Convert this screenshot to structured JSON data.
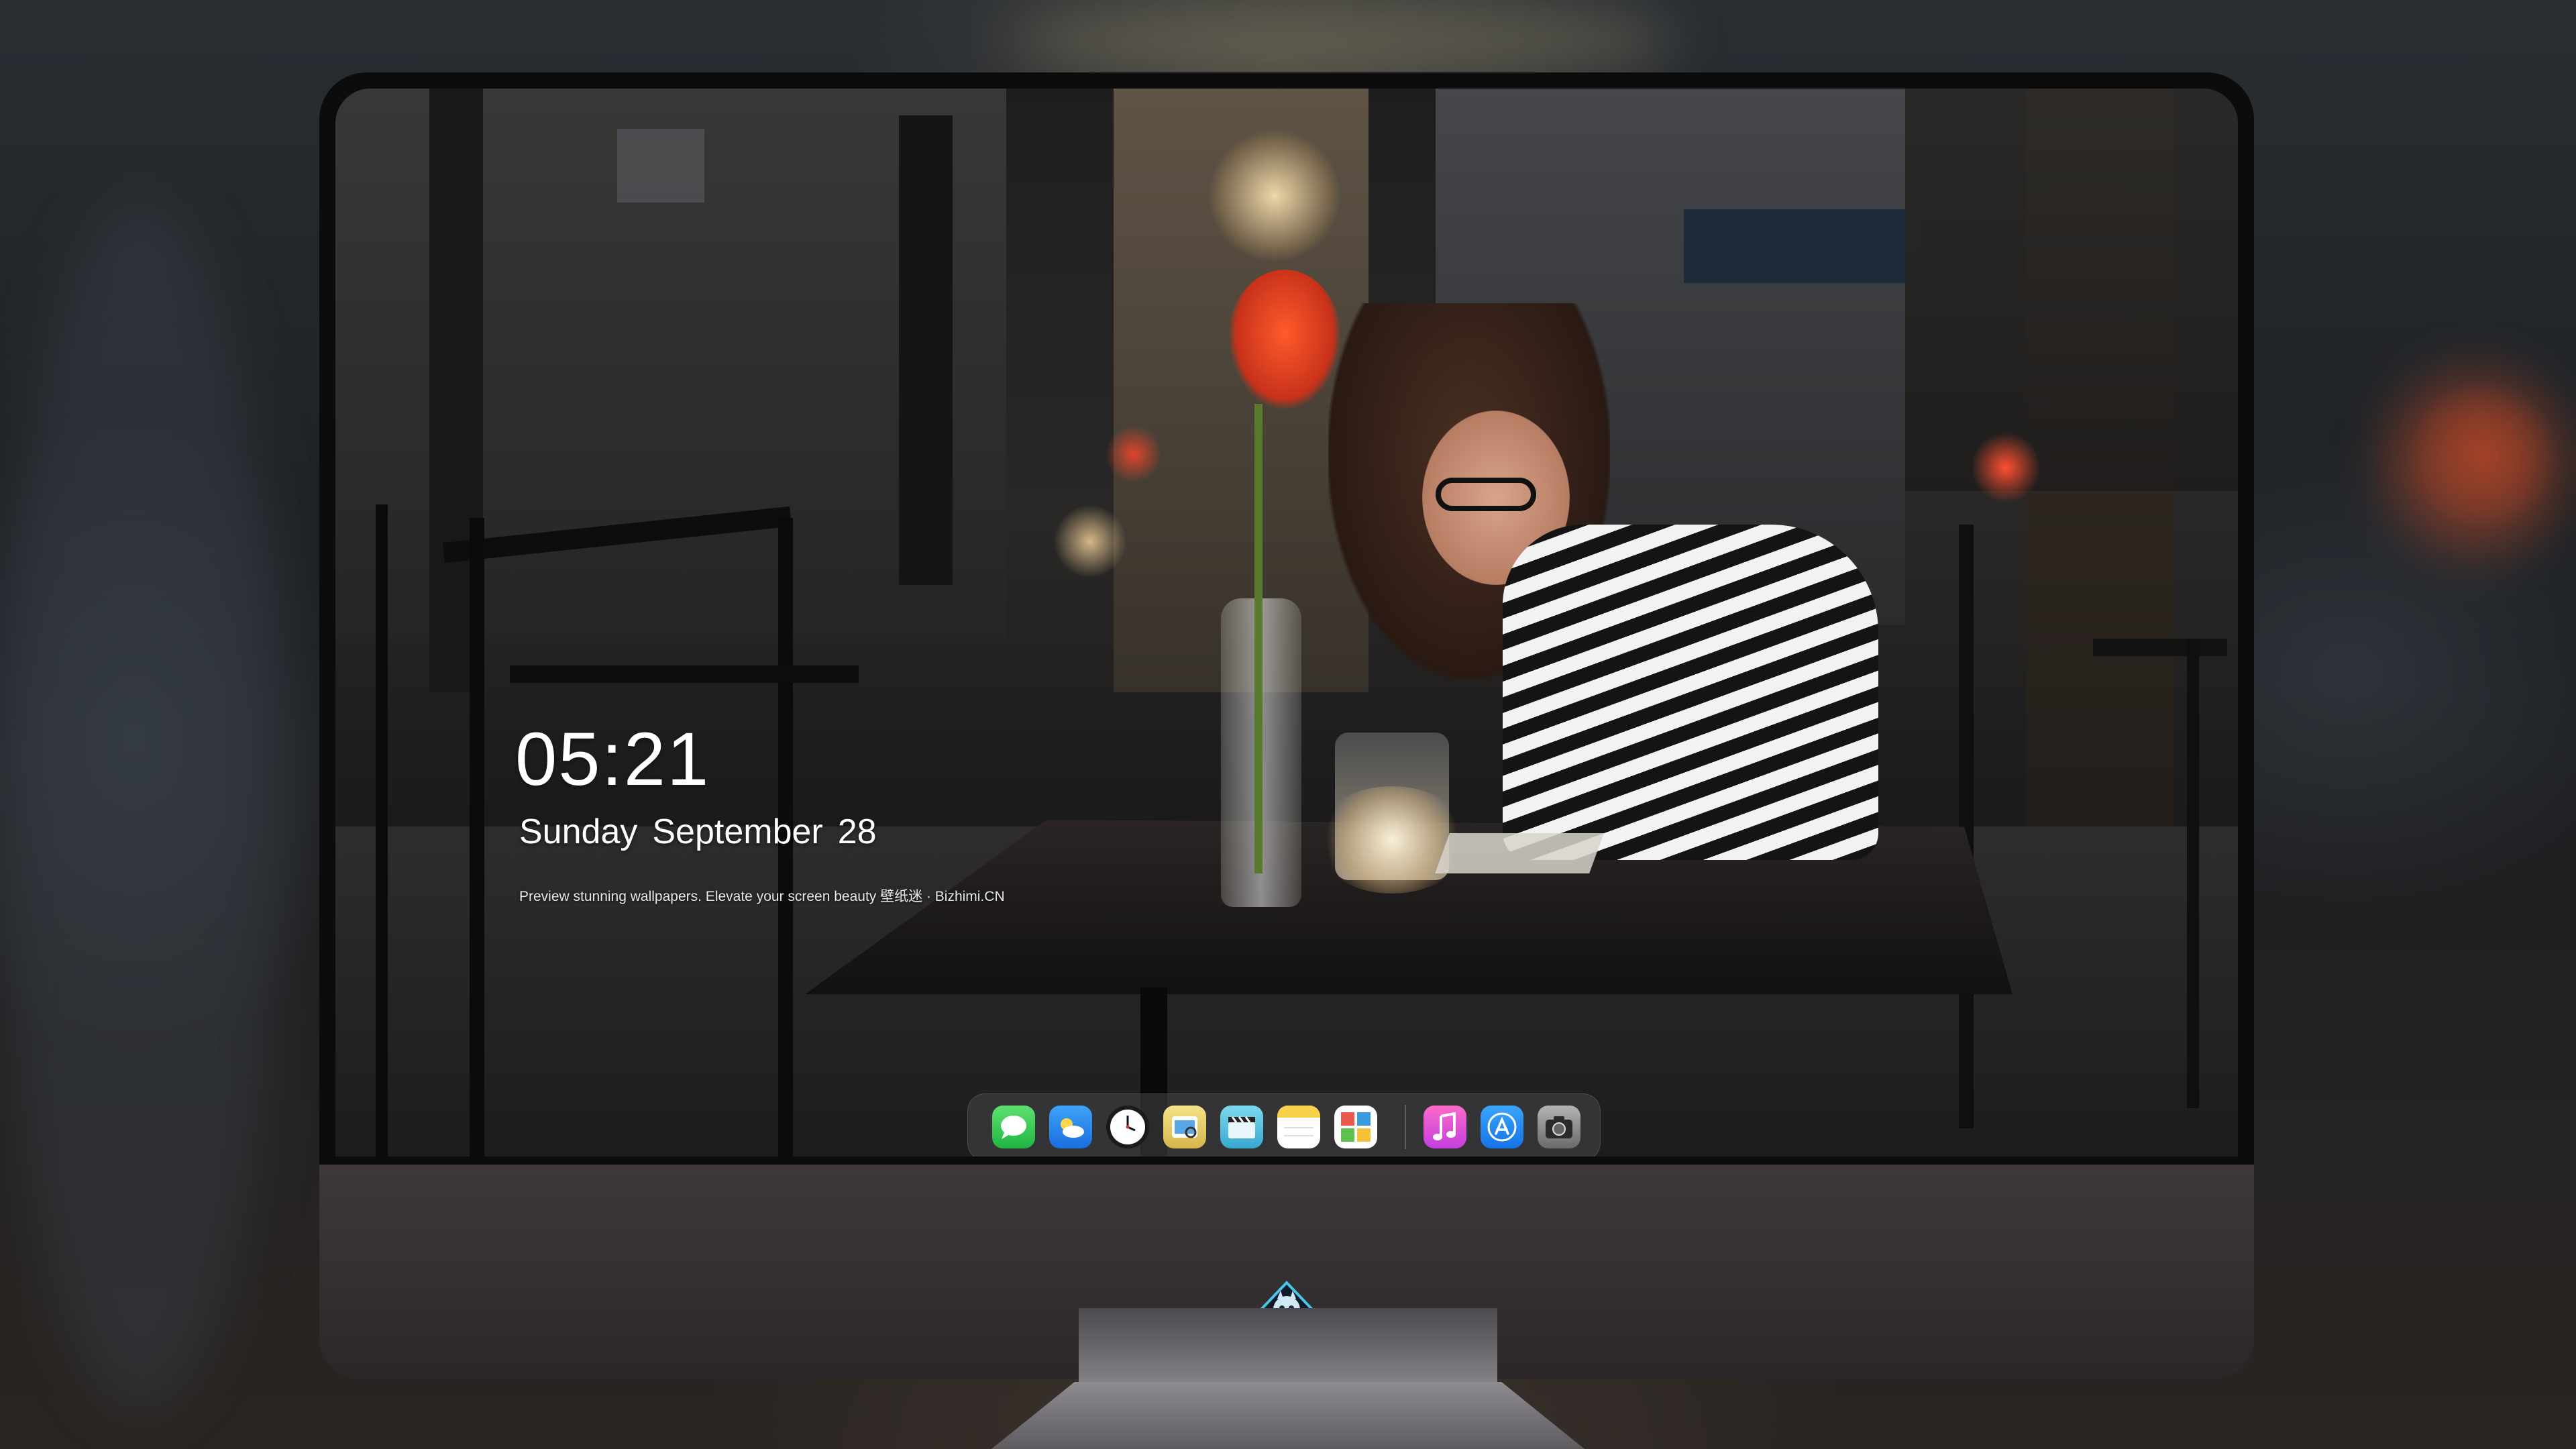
{
  "lock_screen": {
    "time": "05:21",
    "weekday": "Sunday",
    "month": "September",
    "day": "28",
    "tagline": "Preview stunning wallpapers. Elevate your screen beauty  壁纸迷 · Bizhimi.CN"
  },
  "dock": {
    "apps": [
      {
        "name": "messages-icon",
        "color": "#30c74b"
      },
      {
        "name": "weather-icon",
        "color": "#2a8cf0"
      },
      {
        "name": "clock-icon",
        "color": "#ffffff"
      },
      {
        "name": "preview-icon",
        "color": "#e9d46b"
      },
      {
        "name": "final-cut-icon",
        "color": "#59c7e6"
      },
      {
        "name": "notes-icon",
        "color": "#f8d14a"
      },
      {
        "name": "photo-booth-icon",
        "color": "#e55a4a"
      },
      {
        "name": "music-icon",
        "color": "#f05fbc"
      },
      {
        "name": "app-store-icon",
        "color": "#1f8cf5"
      },
      {
        "name": "camera-icon",
        "color": "#8a8a8a"
      }
    ]
  },
  "monitor": {
    "logo": "dragon-mascot-logo",
    "bezel_color": "#0c0c0d",
    "chin_color": "#3a3434"
  }
}
